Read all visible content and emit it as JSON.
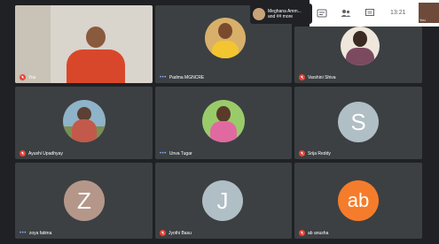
{
  "participants": [
    {
      "name": "You",
      "kind": "video",
      "muted": true
    },
    {
      "name": "Padma MGNCRE",
      "kind": "photo",
      "muted": false,
      "speaking": true
    },
    {
      "name": "Varshini Shiva",
      "kind": "photo",
      "muted": true
    },
    {
      "name": "Ayushi Upadhyay",
      "kind": "photo",
      "muted": true
    },
    {
      "name": "Unva Tugar",
      "kind": "photo",
      "muted": false,
      "speaking": true
    },
    {
      "name": "Srija Reddy",
      "kind": "letter",
      "letter": "S",
      "color": "#b0bec5",
      "muted": true
    },
    {
      "name": "zoya fatima",
      "kind": "letter",
      "letter": "Z",
      "color": "#b5978a",
      "muted": false,
      "speaking": true
    },
    {
      "name": "Jyothi Basu",
      "kind": "letter",
      "letter": "J",
      "color": "#b0bec5",
      "muted": true
    },
    {
      "name": "ab anusha",
      "kind": "letter",
      "letter": "ab",
      "color": "#f57c2b",
      "muted": true
    }
  ],
  "toast": {
    "line1": "Meghana Amm...",
    "line2": "and ## more"
  },
  "topbar": {
    "time": "13:21",
    "self_label": "You"
  },
  "icons": [
    "mic-off-icon",
    "people-icon",
    "chat-icon",
    "info-icon"
  ]
}
